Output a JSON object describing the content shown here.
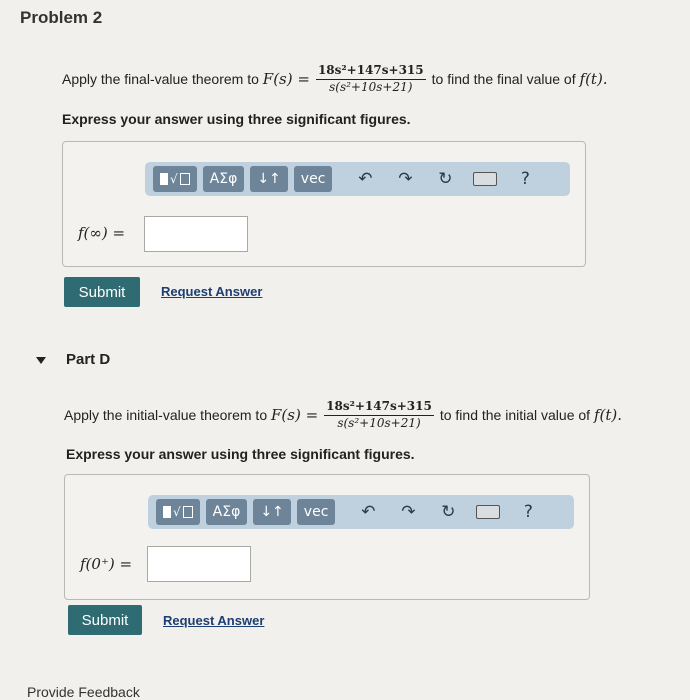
{
  "header": {
    "title": "Problem 2"
  },
  "problem1": {
    "text_before": "Apply the final-value theorem to",
    "func": "F(s) =",
    "numerator": "18s²+147s+315",
    "denominator": "s(s²+10s+21)",
    "text_after": "to find the final value of",
    "target": "f(t).",
    "instruction": "Express your answer using three significant figures.",
    "answer_label": "f(∞) =",
    "answer_value": "",
    "submit_label": "Submit",
    "request_label": "Request Answer"
  },
  "toolbar": {
    "greek_label": "ΑΣφ",
    "arrows_label": "↓↑",
    "vec_label": "vec",
    "help_label": "?"
  },
  "partD": {
    "title": "Part D",
    "text_before": "Apply the initial-value theorem to",
    "func": "F(s) =",
    "numerator": "18s²+147s+315",
    "denominator": "s(s²+10s+21)",
    "text_after": "to find the initial value of",
    "target": "f(t).",
    "instruction": "Express your answer using three significant figures.",
    "answer_label": "f(0⁺) =",
    "answer_value": "",
    "submit_label": "Submit",
    "request_label": "Request Answer"
  },
  "footer": {
    "feedback_label": "Provide Feedback"
  }
}
